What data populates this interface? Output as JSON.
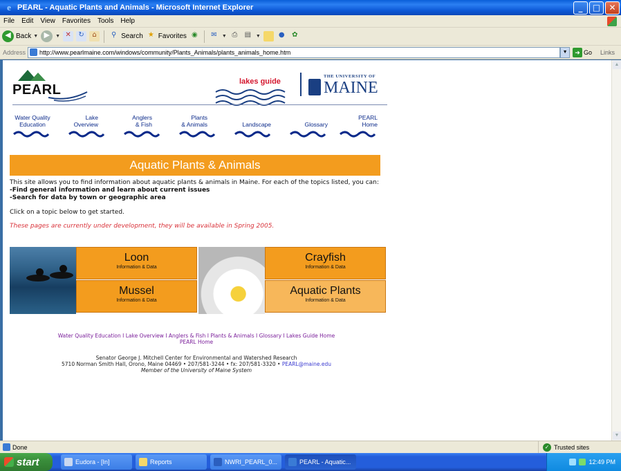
{
  "window": {
    "title": "PEARL - Aquatic Plants and Animals - Microsoft Internet Explorer",
    "buttons": {
      "minimize": "_",
      "maximize": "□",
      "close": "✕"
    }
  },
  "menubar": [
    "File",
    "Edit",
    "View",
    "Favorites",
    "Tools",
    "Help"
  ],
  "toolbar": {
    "back_label": "Back",
    "search_label": "Search",
    "favorites_label": "Favorites"
  },
  "addressbar": {
    "label": "Address",
    "url": "http://www.pearlmaine.com/windows/community/Plants_Animals/plants_animals_home.htm",
    "go_label": "Go",
    "links_label": "Links"
  },
  "page": {
    "logo": "PEARL",
    "lakes_guide": "lakes guide",
    "university": {
      "small": "THE UNIVERSITY OF",
      "big": "MAINE"
    },
    "nav": [
      {
        "label": "Water Quality\nEducation"
      },
      {
        "label": "Lake\nOverview"
      },
      {
        "label": "Anglers\n& Fish"
      },
      {
        "label": "Plants\n& Animals"
      },
      {
        "label": "\nLandscape"
      },
      {
        "label": "\nGlossary"
      },
      {
        "label": "PEARL\nHome"
      }
    ],
    "banner": "Aquatic Plants & Animals",
    "intro": "This site allows you to find information about aquatic plants & animals in Maine. For each of the topics listed, you can:",
    "bullets": [
      "-Find general information and learn about current issues",
      "-Search for data by town or geographic area"
    ],
    "click_text": "Click on a topic below to get started.",
    "dev_notice": "These pages are currently under development, they will be available in Spring 2005.",
    "tiles": {
      "loon": {
        "main": "Loon",
        "sub": "Information & Data"
      },
      "mussel": {
        "main": "Mussel",
        "sub": "Information & Data"
      },
      "crayfish": {
        "main": "Crayfish",
        "sub": "Information & Data"
      },
      "plants": {
        "main": "Aquatic Plants",
        "sub": "Information & Data"
      }
    },
    "footer_links": "Water Quality Education I Lake Overview I Anglers & Fish I Plants & Animals I Glossary I Lakes Guide Home",
    "footer_links_2": "PEARL Home",
    "footer_center": "Senator George J. Mitchell Center for Environmental and Watershed Research",
    "footer_address": "5710 Norman Smith Hall, Orono, Maine 04469 • 207/581-3244 • fx: 207/581-3320 •",
    "footer_email": "PEARL@maine.edu",
    "footer_member": "Member of the University of Maine System"
  },
  "statusbar": {
    "status": "Done",
    "zone": "Trusted sites"
  },
  "taskbar": {
    "start": "start",
    "tasks": [
      "Eudora - [In]",
      "Reports",
      "NWRI_PEARL_0...",
      "PEARL - Aquatic..."
    ],
    "clock": "12:49 PM"
  },
  "colors": {
    "banner_orange": "#f39c1e",
    "nav_blue": "#0b2a8a",
    "dev_red": "#d9323a",
    "footer_purple": "#7a1e9a",
    "maine_blue": "#1a3f82"
  }
}
